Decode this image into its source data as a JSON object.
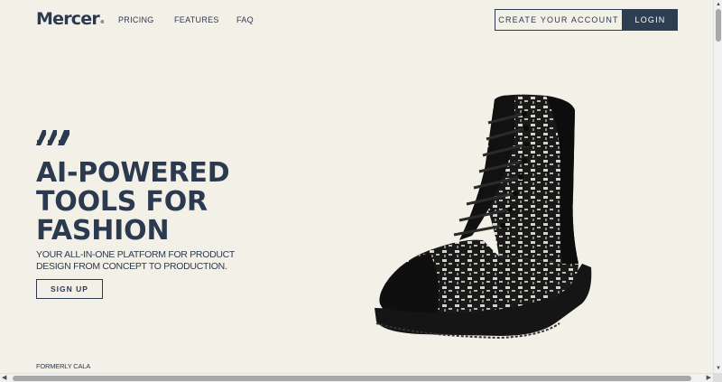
{
  "header": {
    "logo": "Mercer",
    "logo_mark": "®",
    "nav": [
      {
        "label": "PRICING",
        "name": "nav-pricing"
      },
      {
        "label": "FEATURES",
        "name": "nav-features"
      },
      {
        "label": "FAQ",
        "name": "nav-faq"
      }
    ],
    "create_account_label": "CREATE YOUR ACCOUNT",
    "login_label": "LOGIN"
  },
  "hero": {
    "icon": "brand-slashes-icon",
    "title_lines": [
      "AI-POWERED",
      "TOOLS FOR",
      "FASHION"
    ],
    "subtitle_lines": [
      "YOUR ALL-IN-ONE PLATFORM FOR PRODUCT",
      "DESIGN FROM CONCEPT TO PRODUCTION."
    ],
    "signup_label": "SIGN UP",
    "image": "combat-boot-image"
  },
  "footer_note": "FORMERLY CALA",
  "colors": {
    "background": "#f3f0e8",
    "primary": "#2b3a4e",
    "login_bg": "#2e3e52"
  }
}
